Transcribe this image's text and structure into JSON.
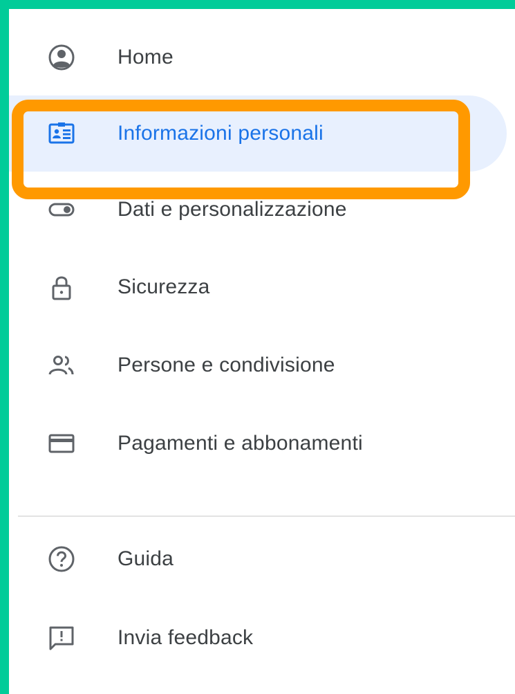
{
  "nav": {
    "items": [
      {
        "label": "Home",
        "icon": "account-circle-icon"
      },
      {
        "label": "Informazioni personali",
        "icon": "id-card-icon",
        "active": true
      },
      {
        "label": "Dati e personalizzazione",
        "icon": "toggle-icon"
      },
      {
        "label": "Sicurezza",
        "icon": "lock-icon"
      },
      {
        "label": "Persone e condivisione",
        "icon": "people-icon"
      },
      {
        "label": "Pagamenti e abbonamenti",
        "icon": "credit-card-icon"
      }
    ],
    "footer_items": [
      {
        "label": "Guida",
        "icon": "help-icon"
      },
      {
        "label": "Invia feedback",
        "icon": "feedback-icon"
      }
    ]
  },
  "colors": {
    "frame": "#00CC99",
    "active_text": "#1a73e8",
    "active_background": "#e8f0fe",
    "highlight_border": "#FF9900",
    "text": "#3c4043",
    "icon": "#5f6368"
  }
}
